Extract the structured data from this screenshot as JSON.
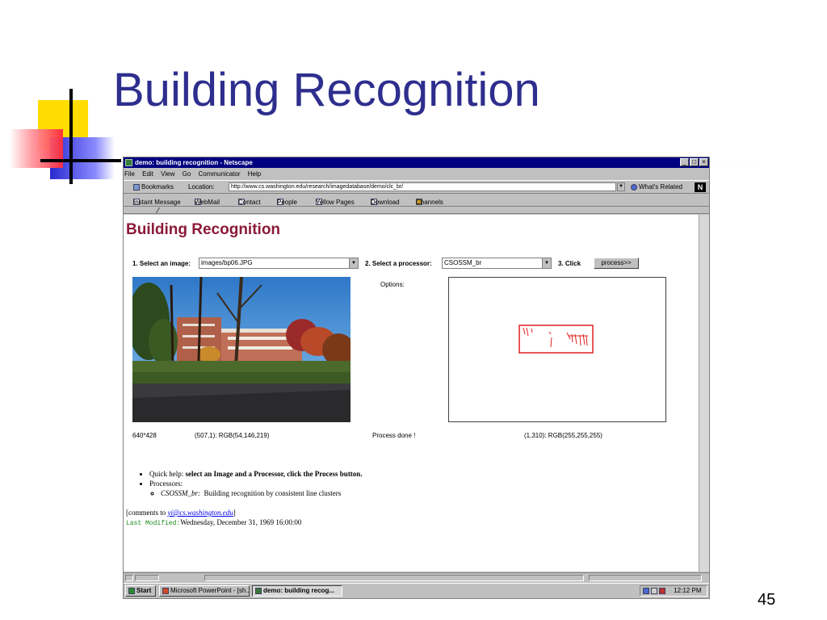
{
  "slide": {
    "title": "Building Recognition",
    "page_number": "45"
  },
  "browser": {
    "window_title": "demo: building recognition - Netscape",
    "menu": [
      "File",
      "Edit",
      "View",
      "Go",
      "Communicator",
      "Help"
    ],
    "bookmarks_label": "Bookmarks",
    "location_label": "Location:",
    "url": "http://www.cs.washington.edu/research/imagedatabase/demo/clc_br/",
    "whats_related": "What's Related",
    "personal_toolbar": [
      "Instant Message",
      "WebMail",
      "Contact",
      "People",
      "Yellow Pages",
      "Download",
      "Channels"
    ]
  },
  "page": {
    "title": "Building Recognition",
    "step1_label": "1. Select an image:",
    "image_value": "images/bp06.JPG",
    "step2_label": "2. Select a processor:",
    "processor_value": "CSOSSM_br",
    "step3_label": "3. Click",
    "process_button": "process>>",
    "options_label": "Options:",
    "image_size": "640*428",
    "left_pixel": "(507,1): RGB(54,146,219)",
    "process_status": "Process done !",
    "right_pixel": "(1,310): RGB(255,255,255)",
    "help": {
      "quick_help_prefix": "Quick help:",
      "quick_help_text": "select an Image and a Processor, click the Process button.",
      "processors_label": "Processors:",
      "processor_name": "CSOSSM_br:",
      "processor_desc": "Building recognition by consistent line clusters"
    },
    "comments_prefix": "[comments to",
    "comments_email": "yi@cs.washington.edu",
    "comments_suffix": "]",
    "last_modified_label": "Last Modified:",
    "last_modified_value": "Wednesday, December 31, 1969 16:00:00"
  },
  "taskbar": {
    "start": "Start",
    "items": [
      "Microsoft PowerPoint - [sh...",
      "demo: building recog..."
    ],
    "clock": "12:12 PM"
  },
  "colors": {
    "slide_title": "#2e2e8e",
    "page_title": "#8b1a3a",
    "titlebar": "#000080",
    "last_modified_label": "#1a8a1a"
  }
}
